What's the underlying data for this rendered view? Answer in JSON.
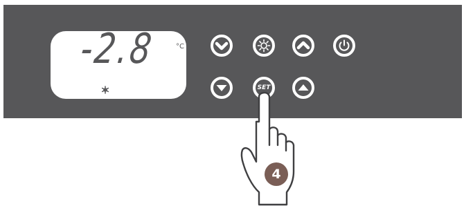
{
  "display": {
    "reading": "-2.8",
    "unit": "°C",
    "status_icon": "snowflake-icon"
  },
  "buttons": {
    "row1": [
      {
        "icon": "chevron-down-icon"
      },
      {
        "icon": "sun-icon"
      },
      {
        "icon": "chevron-up-icon"
      },
      {
        "icon": "power-icon"
      }
    ],
    "row2": [
      {
        "icon": "triangle-down-icon"
      },
      {
        "icon": "set-icon",
        "label": "SET"
      },
      {
        "icon": "triangle-up-icon"
      }
    ]
  },
  "instruction": {
    "step": "4",
    "target": "SET"
  },
  "colors": {
    "panel": "#575759",
    "display_bg": "#ffffff",
    "button": "#ffffff",
    "step_badge": "#7a5e56"
  }
}
